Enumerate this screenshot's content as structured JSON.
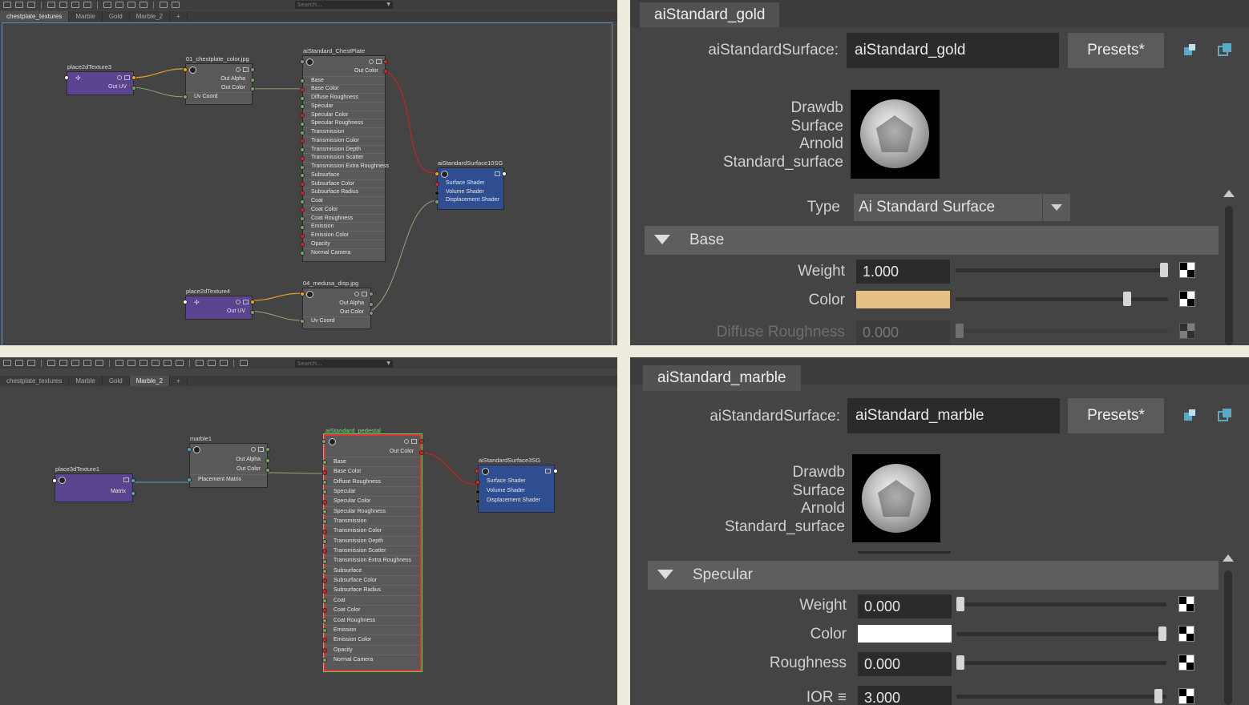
{
  "top_node_editor": {
    "search_placeholder": "Search...",
    "tabs": [
      "chestplate_textures",
      "Marble",
      "Gold",
      "Marble_2",
      "+"
    ],
    "active_tab": "chestplate_textures",
    "nodes": {
      "place2d_a": {
        "title": "place2dTexture3",
        "out": "Out UV"
      },
      "file_a": {
        "title": "01_chestplate_color.jpg",
        "out_alpha": "Out Alpha",
        "out_color": "Out Color",
        "uv": "Uv Coord"
      },
      "shader_a": {
        "title": "aiStandard_ChestPlate",
        "out_color": "Out Color",
        "attrs": [
          "Base",
          "Base Color",
          "Diffuse Roughness",
          "Specular",
          "Specular Color",
          "Specular Roughness",
          "Transmission",
          "Transmission Color",
          "Transmission Depth",
          "Transmission Scatter",
          "Transmission Extra Roughness",
          "Subsurface",
          "Subsurface Color",
          "Subsurface Radius",
          "Coat",
          "Coat Color",
          "Coat Roughness",
          "Emission",
          "Emission Color",
          "Opacity",
          "Normal Camera"
        ]
      },
      "sg_a": {
        "title": "aiStandardSurface10SG",
        "attrs": [
          "Surface Shader",
          "Volume Shader",
          "Displacement Shader"
        ]
      },
      "place2d_b": {
        "title": "place2dTexture4",
        "out": "Out UV"
      },
      "file_b": {
        "title": "04_medusa_disp.jpg",
        "out_alpha": "Out Alpha",
        "out_color": "Out Color",
        "uv": "Uv Coord"
      }
    }
  },
  "bottom_node_editor": {
    "search_placeholder": "Search...",
    "tabs": [
      "chestplate_textures",
      "Marble",
      "Gold",
      "Marble_2",
      "+"
    ],
    "active_tab": "Marble_2",
    "nodes": {
      "place3d": {
        "title": "place3dTexture1",
        "out": "Matrix"
      },
      "marble": {
        "title": "marble1",
        "out_alpha": "Out Alpha",
        "out_color": "Out Color",
        "in": "Placement Matrix"
      },
      "shader_b": {
        "title": "aiStandard_pedestal",
        "out_color": "Out Color",
        "attrs": [
          "Base",
          "Base Color",
          "Diffuse Roughness",
          "Specular",
          "Specular Color",
          "Specular Roughness",
          "Transmission",
          "Transmission Color",
          "Transmission Depth",
          "Transmission Scatter",
          "Transmission Extra Roughness",
          "Subsurface",
          "Subsurface Color",
          "Subsurface Radius",
          "Coat",
          "Coat Color",
          "Coat Roughness",
          "Emission",
          "Emission Color",
          "Opacity",
          "Normal Camera"
        ]
      },
      "sg_b": {
        "title": "aiStandardSurface3SG",
        "attrs": [
          "Surface Shader",
          "Volume Shader",
          "Displacement Shader"
        ]
      }
    }
  },
  "top_attr_editor": {
    "tab": "aiStandard_gold",
    "node_type_label": "aiStandardSurface:",
    "node_name": "aiStandard_gold",
    "presets": "Presets*",
    "swatch_caption": "Drawdb\nSurface\nArnold\nStandard_surface",
    "type_label": "Type",
    "type_value": "Ai Standard Surface",
    "section": "Base",
    "rows": {
      "weight": {
        "label": "Weight",
        "value": "1.000",
        "level": 1.0
      },
      "color": {
        "label": "Color",
        "value": "#e5c186",
        "level": 0.82
      },
      "diffuse": {
        "label": "Diffuse Roughness",
        "value": "0.000",
        "level": 0.0
      }
    }
  },
  "bottom_attr_editor": {
    "tab": "aiStandard_marble",
    "node_type_label": "aiStandardSurface:",
    "node_name": "aiStandard_marble",
    "presets": "Presets*",
    "swatch_caption": "Drawdb\nSurface\nArnold\nStandard_surface",
    "section": "Specular",
    "rows": {
      "weight": {
        "label": "Weight",
        "value": "0.000",
        "level": 0.0
      },
      "color": {
        "label": "Color",
        "value": "#ffffff",
        "level": 1.0
      },
      "roughness": {
        "label": "Roughness",
        "value": "0.000",
        "level": 0.0
      },
      "ior": {
        "label": "IOR ≡",
        "value": "3.000",
        "level": 0.98
      }
    }
  },
  "colors": {
    "node_purple": "#5b448f",
    "node_blue": "#2f4e91",
    "wire_yellow": "#e3a12a",
    "wire_red": "#c82020",
    "wire_green": "#8fa97a",
    "gold_color": "#e5c186"
  }
}
